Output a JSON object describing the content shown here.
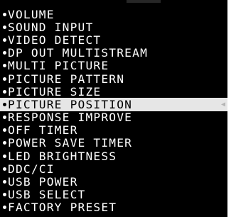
{
  "menu": {
    "items": [
      {
        "label": "VOLUME",
        "selected": false
      },
      {
        "label": "SOUND INPUT",
        "selected": false
      },
      {
        "label": "VIDEO DETECT",
        "selected": false
      },
      {
        "label": "DP OUT MULTISTREAM",
        "selected": false
      },
      {
        "label": "MULTI PICTURE",
        "selected": false
      },
      {
        "label": "PICTURE PATTERN",
        "selected": false
      },
      {
        "label": "PICTURE SIZE",
        "selected": false
      },
      {
        "label": "PICTURE POSITION",
        "selected": true
      },
      {
        "label": "RESPONSE IMPROVE",
        "selected": false
      },
      {
        "label": "OFF TIMER",
        "selected": false
      },
      {
        "label": "POWER SAVE TIMER",
        "selected": false
      },
      {
        "label": "LED BRIGHTNESS",
        "selected": false
      },
      {
        "label": "DDC/CI",
        "selected": false
      },
      {
        "label": "USB POWER",
        "selected": false
      },
      {
        "label": "USB SELECT",
        "selected": false
      },
      {
        "label": "FACTORY PRESET",
        "selected": false
      }
    ],
    "selected_icon": "chevron-left-icon",
    "colors": {
      "background": "#000000",
      "text": "#ffffff",
      "highlight_background": "#e6e6e6",
      "highlight_text": "#000000"
    }
  }
}
